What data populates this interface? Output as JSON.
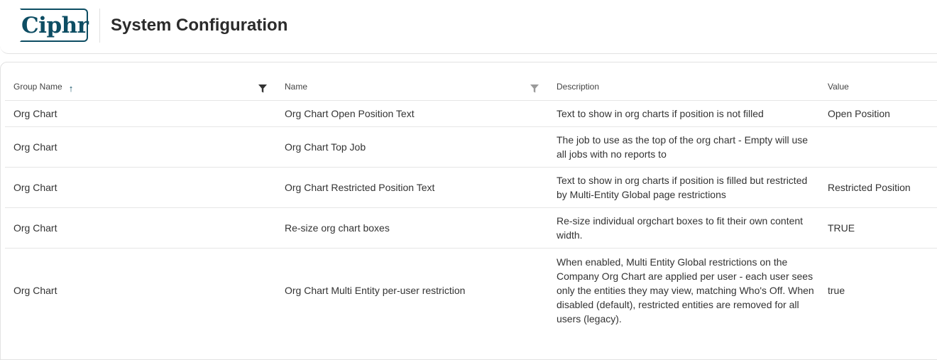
{
  "app": {
    "logo_text": "Ciphr",
    "page_title": "System Configuration"
  },
  "colors": {
    "brand": "#0d4d63",
    "text": "#333333",
    "border": "#e6e6e6",
    "filter_active": "#333333",
    "filter_inactive": "#9a9a9a"
  },
  "table": {
    "columns": [
      {
        "label": "Group Name",
        "sorted": "ascending",
        "sort_icon": "arrow-up-icon",
        "filter_icon": "filter-icon",
        "filter_active": true
      },
      {
        "label": "Name",
        "filter_icon": "filter-icon",
        "filter_active": false
      },
      {
        "label": "Description"
      },
      {
        "label": "Value"
      }
    ],
    "rows": [
      {
        "group": "Org Chart",
        "name": "Org Chart Open Position Text",
        "description": "Text to show in org charts if position is not filled",
        "value": "Open Position"
      },
      {
        "group": "Org Chart",
        "name": "Org Chart Top Job",
        "description": "The job to use as the top of the org chart - Empty will use all jobs with no reports to",
        "value": ""
      },
      {
        "group": "Org Chart",
        "name": "Org Chart Restricted Position Text",
        "description": "Text to show in org charts if position is filled but restricted by Multi-Entity Global page restrictions",
        "value": "Restricted Position"
      },
      {
        "group": "Org Chart",
        "name": "Re-size org chart boxes",
        "description": "Re-size individual orgchart boxes to fit their own content width.",
        "value": "TRUE"
      },
      {
        "group": "Org Chart",
        "name": "Org Chart Multi Entity per-user restriction",
        "description": "When enabled, Multi Entity Global restrictions on the Company Org Chart are applied per user - each user sees only the entities they may view, matching Who's Off. When disabled (default), restricted entities are removed for all users (legacy).",
        "value": "true"
      }
    ]
  }
}
